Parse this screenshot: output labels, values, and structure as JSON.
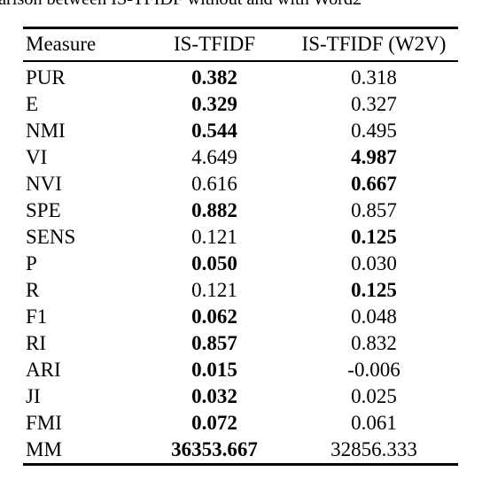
{
  "caption": {
    "text_clipped": "arison between IS-TFIDF without and with Word2"
  },
  "table": {
    "columns": [
      "Measure",
      "IS-TFIDF",
      "IS-TFIDF (W2V)"
    ],
    "rows": [
      {
        "measure": "PUR",
        "is_tfidf": "0.382",
        "is_tfidf_w2v": "0.318",
        "bold": "is_tfidf"
      },
      {
        "measure": "E",
        "is_tfidf": "0.329",
        "is_tfidf_w2v": "0.327",
        "bold": "is_tfidf"
      },
      {
        "measure": "NMI",
        "is_tfidf": "0.544",
        "is_tfidf_w2v": "0.495",
        "bold": "is_tfidf"
      },
      {
        "measure": "VI",
        "is_tfidf": "4.649",
        "is_tfidf_w2v": "4.987",
        "bold": "is_tfidf_w2v"
      },
      {
        "measure": "NVI",
        "is_tfidf": "0.616",
        "is_tfidf_w2v": "0.667",
        "bold": "is_tfidf_w2v"
      },
      {
        "measure": "SPE",
        "is_tfidf": "0.882",
        "is_tfidf_w2v": "0.857",
        "bold": "is_tfidf"
      },
      {
        "measure": "SENS",
        "is_tfidf": "0.121",
        "is_tfidf_w2v": "0.125",
        "bold": "is_tfidf_w2v"
      },
      {
        "measure": "P",
        "is_tfidf": "0.050",
        "is_tfidf_w2v": "0.030",
        "bold": "is_tfidf"
      },
      {
        "measure": "R",
        "is_tfidf": "0.121",
        "is_tfidf_w2v": "0.125",
        "bold": "is_tfidf_w2v"
      },
      {
        "measure": "F1",
        "is_tfidf": "0.062",
        "is_tfidf_w2v": "0.048",
        "bold": "is_tfidf"
      },
      {
        "measure": "RI",
        "is_tfidf": "0.857",
        "is_tfidf_w2v": "0.832",
        "bold": "is_tfidf"
      },
      {
        "measure": "ARI",
        "is_tfidf": "0.015",
        "is_tfidf_w2v": "-0.006",
        "bold": "is_tfidf"
      },
      {
        "measure": "JI",
        "is_tfidf": "0.032",
        "is_tfidf_w2v": "0.025",
        "bold": "is_tfidf"
      },
      {
        "measure": "FMI",
        "is_tfidf": "0.072",
        "is_tfidf_w2v": "0.061",
        "bold": "is_tfidf"
      },
      {
        "measure": "MM",
        "is_tfidf": "36353.667",
        "is_tfidf_w2v": "32856.333",
        "bold": "is_tfidf"
      }
    ]
  }
}
